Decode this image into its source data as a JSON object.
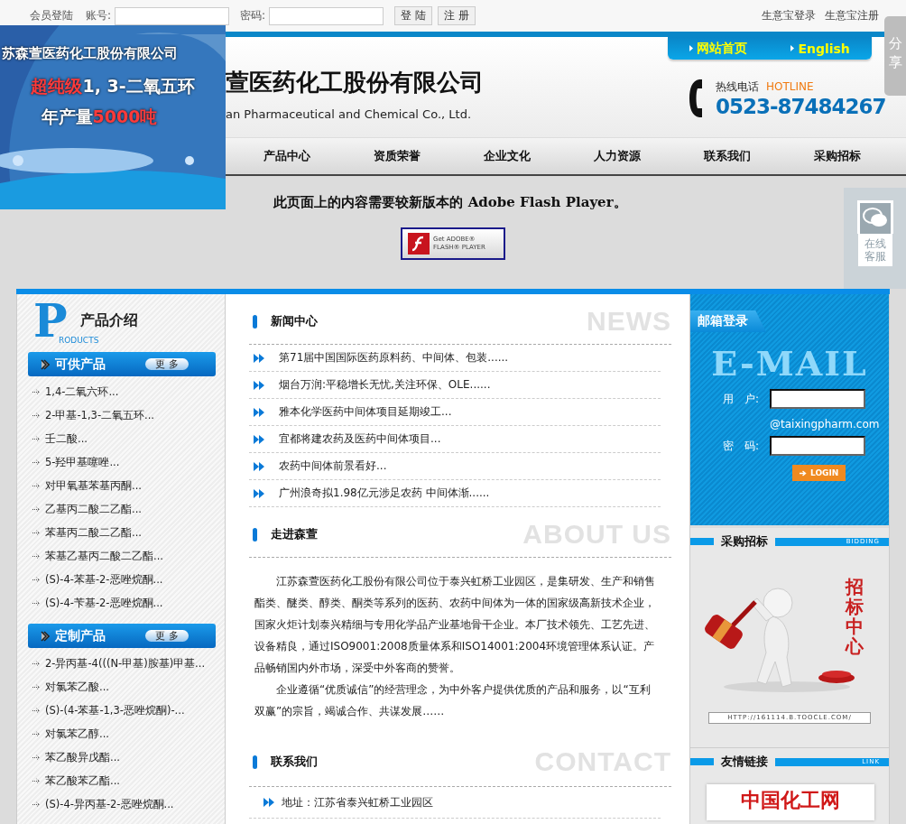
{
  "top_bar": {
    "title": "会员登陆",
    "account_label": "账号:",
    "password_label": "密码:",
    "buttons": [
      "登 陆",
      "注 册"
    ],
    "links": [
      "生意宝登录",
      "生意宝注册"
    ]
  },
  "share_tab": {
    "label": "分享"
  },
  "banner": {
    "company": "苏森萱医药化工股份有限公司",
    "lines": [
      [
        {
          "text": "超纯级",
          "highlight": true
        },
        {
          "text": "1, 3-二氧五环",
          "highlight": false
        }
      ],
      [
        {
          "text": "年产量",
          "highlight": false
        },
        {
          "text": "5000吨",
          "highlight": true
        }
      ]
    ]
  },
  "header": {
    "company_name": "萱医药化工股份有限公司",
    "company_name_en": "an Pharmaceutical and Chemical Co., Ltd.",
    "top_links": [
      "网站首页",
      "English"
    ],
    "hotline_label": "热线电话",
    "hotline_label_en": "HOTLINE",
    "hotline": "0523-87484267"
  },
  "nav": [
    "产品中心",
    "资质荣誉",
    "企业文化",
    "人力资源",
    "联系我们",
    "采购招标"
  ],
  "flash_notice": {
    "text": "此页面上的内容需要较新版本的 Adobe Flash Player。",
    "button_lines": [
      "Get ADOBE®",
      "FLASH® PLAYER"
    ]
  },
  "chat_widget": {
    "label": "在线客服"
  },
  "products": {
    "title_letter": "P",
    "title": "产品介绍",
    "subtitle": "RODUCTS",
    "groups": [
      {
        "title": "可供产品",
        "more": "更 多",
        "items": [
          "1,4-二氧六环...",
          "2-甲基-1,3-二氧五环...",
          "壬二酸...",
          "5-羟甲基噻唑...",
          "对甲氧基苯基丙酮...",
          "乙基丙二酸二乙酯...",
          "苯基丙二酸二乙酯...",
          "苯基乙基丙二酸二乙酯...",
          "(S)-4-苯基-2-恶唑烷酮...",
          "(S)-4-苄基-2-恶唑烷酮..."
        ]
      },
      {
        "title": "定制产品",
        "more": "更 多",
        "items": [
          "2-异丙基-4(((N-甲基)胺基)甲基...",
          "对氯苯乙酸...",
          "(S)-(4-苯基-1,3-恶唑烷酮)-...",
          "对氯苯乙醇...",
          "苯乙酸异戊酯...",
          "苯乙酸苯乙酯...",
          "(S)-4-异丙基-2-恶唑烷酮..."
        ]
      }
    ]
  },
  "sections": [
    {
      "kind": "news",
      "title": "新闻中心",
      "watermark": "NEWS",
      "items": [
        "第71届中国国际医药原料药、中间体、包装......",
        "烟台万润:平稳增长无忧,关注环保、OLE......",
        "雅本化学医药中间体项目延期竣工...",
        "宜都将建农药及医药中间体项目...",
        "农药中间体前景看好...",
        "广州浪奇拟1.98亿元涉足农药 中间体渐......"
      ]
    },
    {
      "kind": "about",
      "title": "走进森萱",
      "watermark": "ABOUT US",
      "paragraphs": [
        "江苏森萱医药化工股份有限公司位于泰兴虹桥工业园区，是集研发、生产和销售酯类、醚类、醇类、酮类等系列的医药、农药中间体为一体的国家级高新技术企业，国家火炬计划泰兴精细与专用化学品产业基地骨干企业。本厂技术领先、工艺先进、设备精良，通过ISO9001:2008质量体系和ISO14001:2004环境管理体系认证。产品畅销国内外市场，深受中外客商的赞誉。",
        "企业遵循“优质诚信”的经营理念，为中外客户提供优质的产品和服务，以“互利双赢”的宗旨，竭诚合作、共谋发展……"
      ]
    },
    {
      "kind": "contact",
      "title": "联系我们",
      "watermark": "CONTACT",
      "items": [
        "地址：江苏省泰兴虹桥工业园区"
      ]
    }
  ],
  "email_login": {
    "tab": "邮箱登录",
    "heading": "E-MAIL",
    "user_label": "用　户:",
    "domain": "@taixingpharm.com",
    "password_label": "密　码:",
    "button": "LOGIN"
  },
  "bidding": {
    "title": "采购招标",
    "title_en": "BIDDING",
    "poster_text": "招标中心",
    "url": "HTTP://161114.B.TOOCLE.COM/"
  },
  "friend_links": {
    "title": "友情链接",
    "title_en": "LINK",
    "logo_text": "中国化工网"
  }
}
